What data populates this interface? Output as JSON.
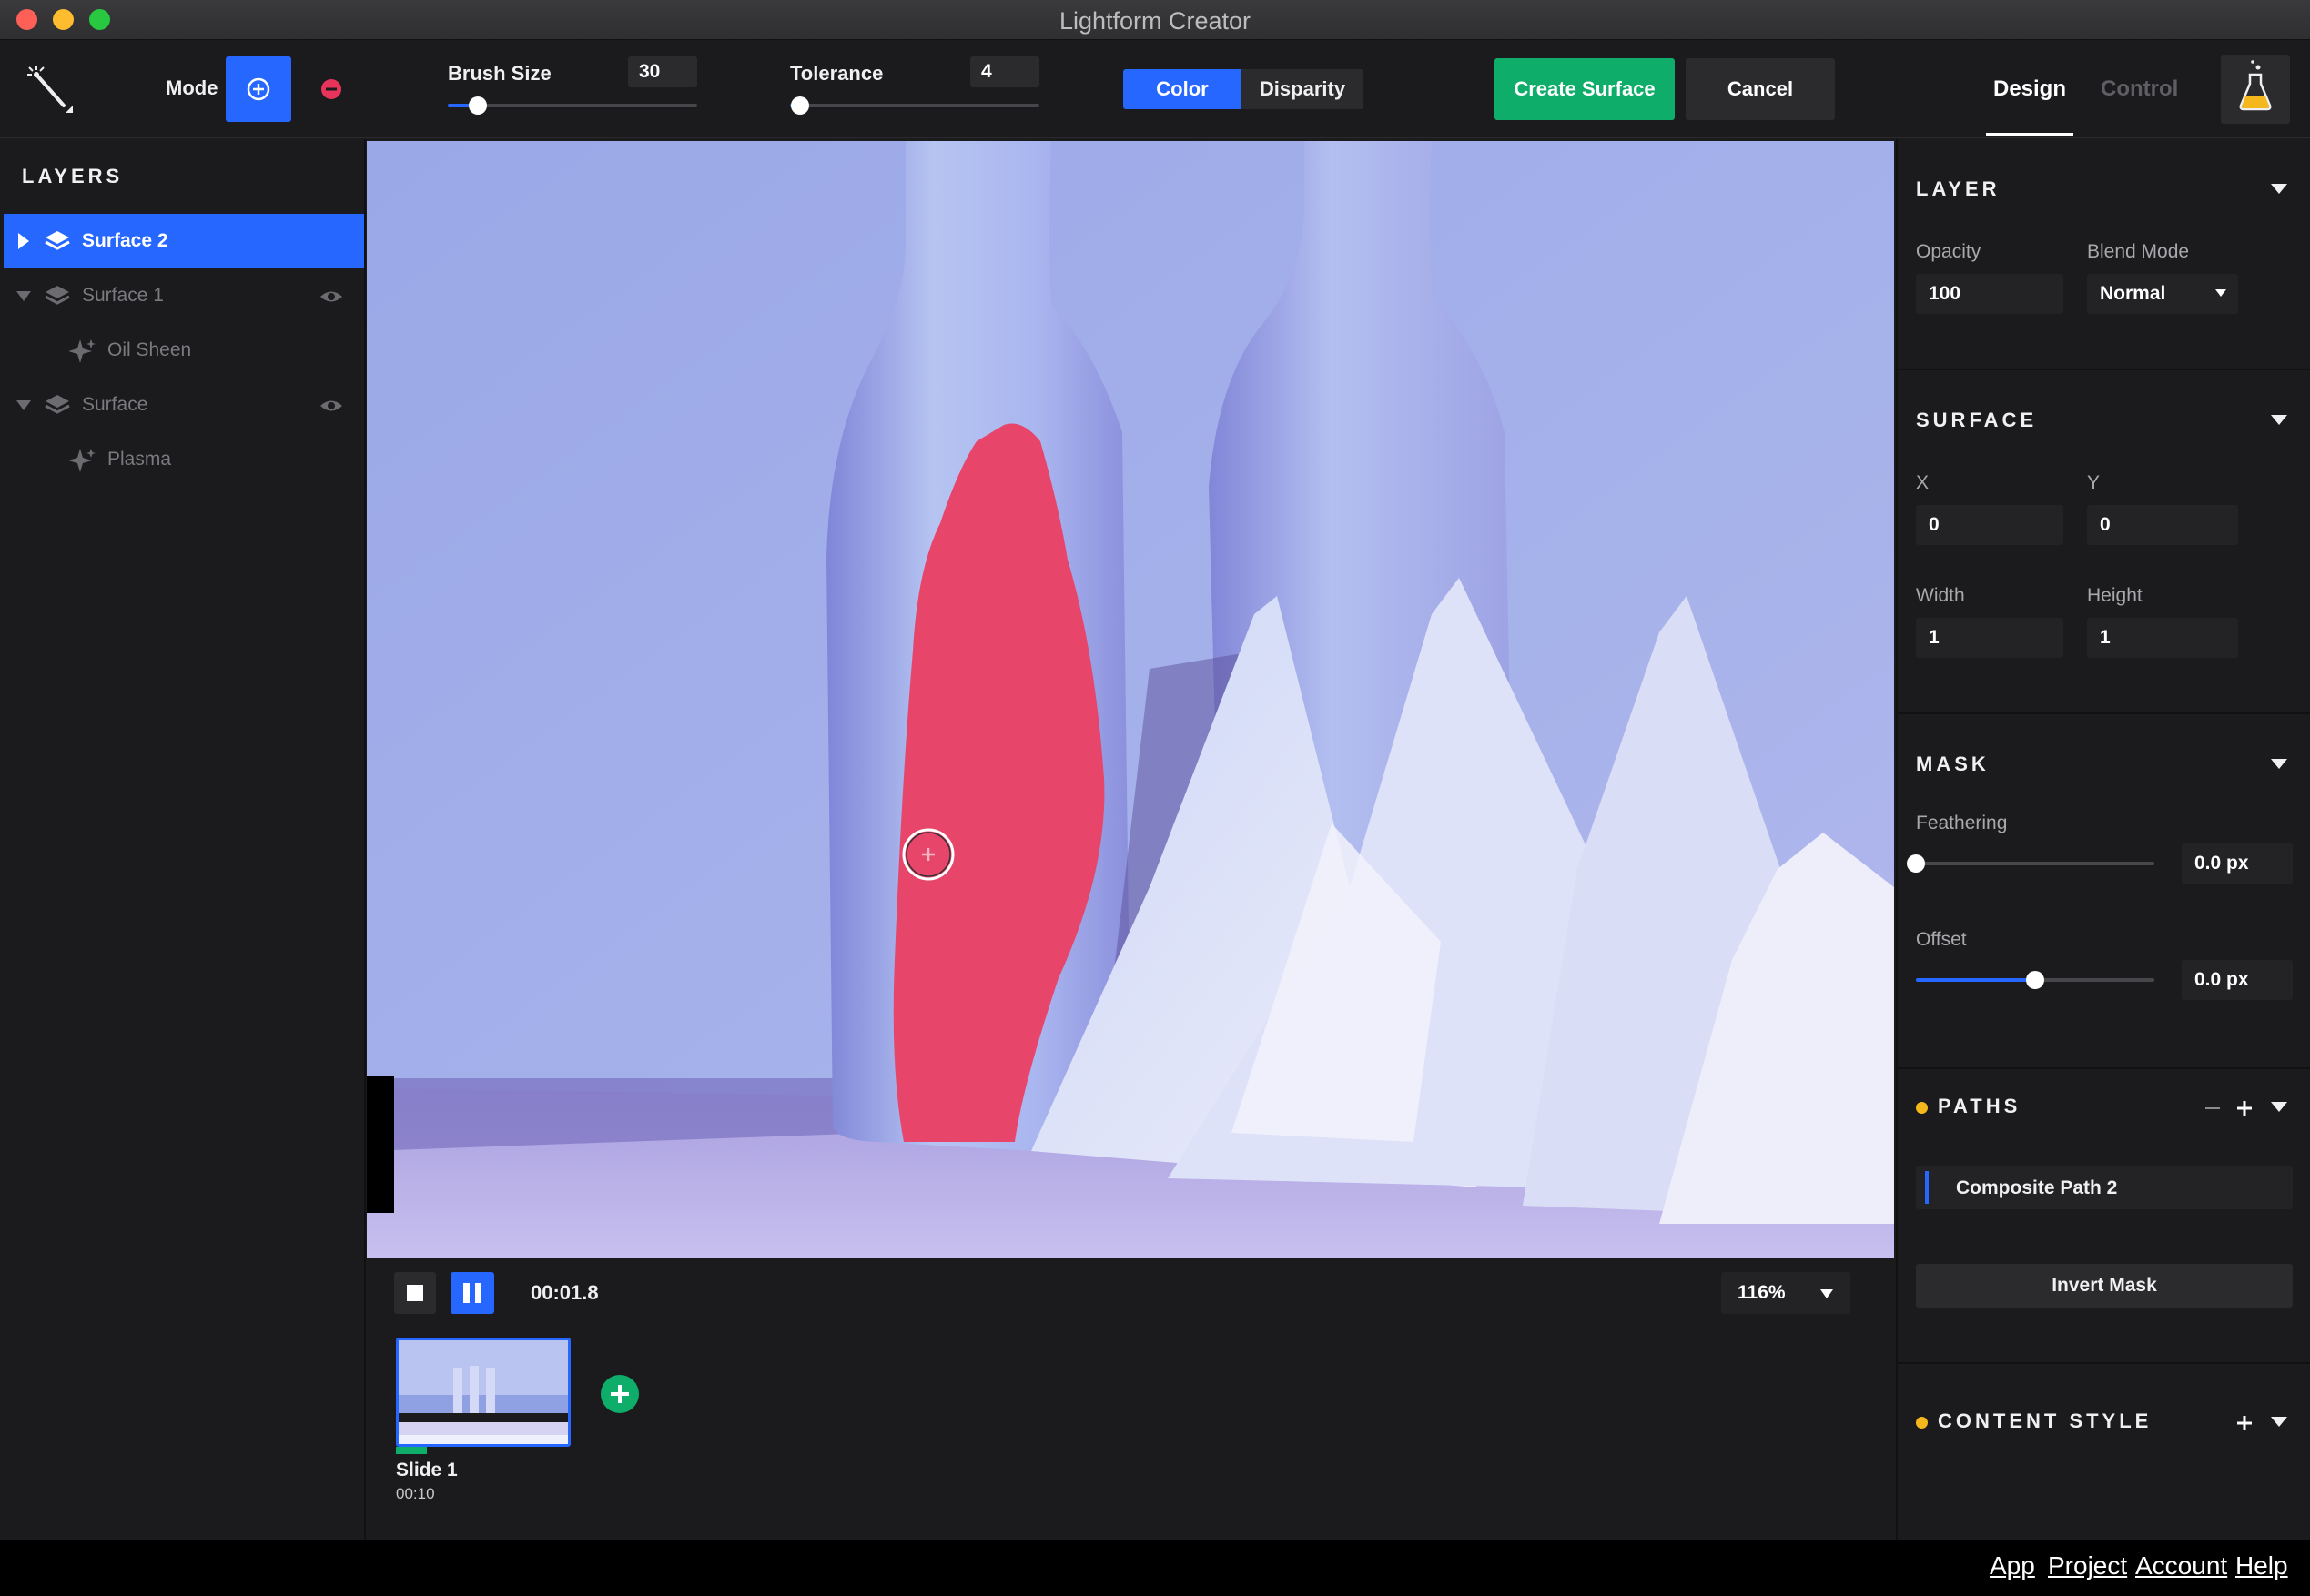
{
  "window": {
    "title": "Lightform Creator"
  },
  "toolbar": {
    "mode_label": "Mode",
    "brush_size_label": "Brush Size",
    "brush_size_value": "30",
    "brush_size_fraction": 0.12,
    "tolerance_label": "Tolerance",
    "tolerance_value": "4",
    "tolerance_fraction": 0.04,
    "segment": [
      "Color",
      "Disparity"
    ],
    "create_surface": "Create Surface",
    "cancel": "Cancel",
    "tabs": {
      "design": "Design",
      "control": "Control"
    },
    "active_tab": "Design"
  },
  "layers": {
    "title": "LAYERS",
    "items": [
      {
        "label": "Surface 2",
        "selected": true,
        "kind": "surface"
      },
      {
        "label": "Surface 1",
        "selected": false,
        "kind": "surface",
        "visible": true
      },
      {
        "label": "Oil Sheen",
        "selected": false,
        "kind": "effect"
      },
      {
        "label": "Surface",
        "selected": false,
        "kind": "surface",
        "visible": true
      },
      {
        "label": "Plasma",
        "selected": false,
        "kind": "effect"
      }
    ]
  },
  "playback": {
    "time": "00:01.8",
    "zoom": "116%",
    "slide": {
      "name": "Slide 1",
      "duration": "00:10"
    }
  },
  "properties": {
    "layer": {
      "title": "LAYER",
      "opacity_label": "Opacity",
      "opacity_value": "100",
      "blend_label": "Blend Mode",
      "blend_value": "Normal"
    },
    "surface": {
      "title": "SURFACE",
      "x_label": "X",
      "x_value": "0",
      "y_label": "Y",
      "y_value": "0",
      "width_label": "Width",
      "width_value": "1",
      "height_label": "Height",
      "height_value": "1"
    },
    "mask": {
      "title": "MASK",
      "feathering_label": "Feathering",
      "feathering_value": "0.0 px",
      "feathering_fraction": 0.0,
      "offset_label": "Offset",
      "offset_value": "0.0 px",
      "offset_fraction": 0.5
    },
    "paths": {
      "title": "PATHS",
      "items": [
        "Composite Path 2"
      ],
      "invert_mask": "Invert Mask"
    },
    "content_style": {
      "title": "CONTENT STYLE"
    }
  },
  "footer": {
    "links": [
      "App",
      "Project",
      "Account",
      "Help"
    ]
  },
  "colors": {
    "accent": "#2667ff",
    "create": "#0fad6a",
    "mask": "#e8456a",
    "dot": "#f5b81c"
  }
}
